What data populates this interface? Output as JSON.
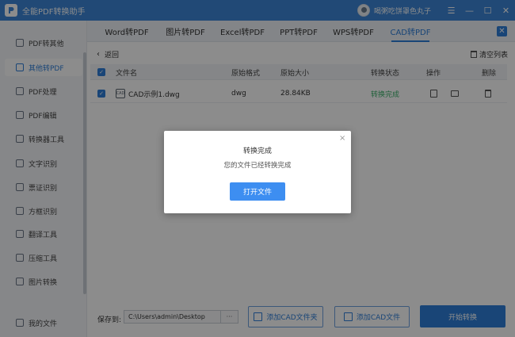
{
  "app": {
    "title": "全能PDF转换助手",
    "username": "喝粥吃饼罩色丸子"
  },
  "window_controls": {
    "menu": "☰",
    "minimize": "—",
    "maximize": "☐",
    "close": "✕"
  },
  "sidebar": {
    "items": [
      {
        "label": "PDF转其他",
        "icon": "pdf-convert-icon",
        "active": false
      },
      {
        "label": "其他转PDF",
        "icon": "to-pdf-icon",
        "active": true
      },
      {
        "label": "PDF处理",
        "icon": "pdf-process-icon",
        "active": false
      },
      {
        "label": "PDF编辑",
        "icon": "pdf-edit-icon",
        "active": false
      },
      {
        "label": "转换器工具",
        "icon": "tools-icon",
        "active": false
      },
      {
        "label": "文字识别",
        "icon": "ocr-icon",
        "active": false
      },
      {
        "label": "票证识别",
        "icon": "ticket-icon",
        "active": false
      },
      {
        "label": "方框识别",
        "icon": "box-recognize-icon",
        "active": false
      },
      {
        "label": "翻译工具",
        "icon": "translate-icon",
        "active": false
      },
      {
        "label": "压缩工具",
        "icon": "compress-icon",
        "active": false
      },
      {
        "label": "图片转换",
        "icon": "image-convert-icon",
        "active": false
      },
      {
        "label": "我的文件",
        "icon": "my-files-icon",
        "active": false
      }
    ]
  },
  "tabs": [
    {
      "label": "Word转PDF"
    },
    {
      "label": "图片转PDF"
    },
    {
      "label": "Excel转PDF"
    },
    {
      "label": "PPT转PDF"
    },
    {
      "label": "WPS转PDF"
    },
    {
      "label": "CAD转PDF",
      "active": true
    }
  ],
  "toolbar": {
    "back_label": "返回",
    "clear_label": "清空列表"
  },
  "table": {
    "headers": {
      "name": "文件名",
      "format": "原始格式",
      "size": "原始大小",
      "status": "转换状态",
      "actions": "操作",
      "delete": "删除"
    },
    "rows": [
      {
        "name": "CAD示例1.dwg",
        "format": "dwg",
        "size": "28.84KB",
        "status": "转换完成"
      }
    ]
  },
  "bottom": {
    "save_label": "保存到:",
    "save_path": "C:\\Users\\admin\\Desktop",
    "path_more": "···",
    "add_folder_label": "添加CAD文件夹",
    "add_file_label": "添加CAD文件",
    "start_label": "开始转换"
  },
  "dialog": {
    "title": "转换完成",
    "message": "您的文件已经转换完成",
    "open_label": "打开文件",
    "close": "×"
  },
  "colors": {
    "accent": "#2f7fd9",
    "titlebar": "#3c86d8",
    "success": "#3bb16b"
  }
}
